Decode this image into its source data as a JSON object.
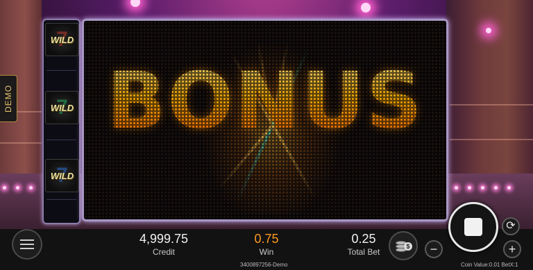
{
  "mode_tab": {
    "label": "DEMO"
  },
  "reel": {
    "symbols": [
      {
        "label": "WILD",
        "seven_color": "#c0392b"
      },
      {
        "label": "WILD",
        "seven_color": "#27ae60"
      },
      {
        "label": "WILD",
        "seven_color": "#2e6fd1"
      }
    ]
  },
  "screen": {
    "headline": "BONUS"
  },
  "status": {
    "credit": {
      "value": "4,999.75",
      "label": "Credit"
    },
    "win": {
      "value": "0.75",
      "label": "Win"
    },
    "total_bet": {
      "value": "0.25",
      "label": "Total Bet"
    }
  },
  "footer": {
    "session_id": "3400897256-Demo",
    "bet_info": "Coin Value:0.01 BetX:1"
  },
  "icons": {
    "menu": "menu-icon",
    "coins": "coin-stack-icon",
    "spin": "stop-square-icon",
    "autoplay": "autoplay-cycle-icon",
    "decrease": "minus-icon",
    "increase": "plus-icon"
  },
  "colors": {
    "win_value": "#ff9b1f",
    "headline": "#ffb400",
    "frame": "#a896c4"
  }
}
